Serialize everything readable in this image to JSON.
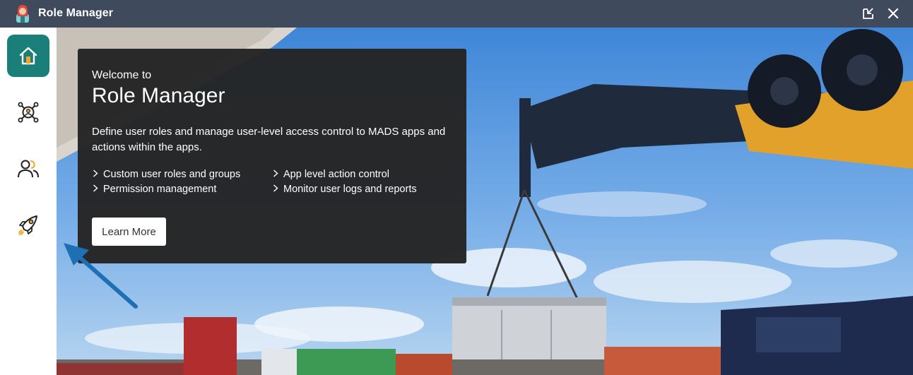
{
  "window": {
    "title": "Role Manager",
    "logo_icon": "user-avatar-icon",
    "popout_icon": "popout-icon",
    "close_icon": "close-icon"
  },
  "sidebar": {
    "items": [
      {
        "name": "home",
        "icon": "home-icon",
        "active": true
      },
      {
        "name": "network",
        "icon": "network-hub-icon",
        "active": false
      },
      {
        "name": "users",
        "icon": "users-icon",
        "active": false
      },
      {
        "name": "launch",
        "icon": "rocket-icon",
        "active": false
      }
    ]
  },
  "welcome": {
    "small": "Welcome to",
    "title": "Role Manager",
    "description": "Define user roles and manage user-level access control to MADS apps and actions within the apps.",
    "features": [
      "Custom user roles and groups",
      "Permission management",
      "App level action control",
      "Monitor user logs and reports"
    ],
    "learn_more": "Learn More"
  },
  "colors": {
    "titlebar": "#3f4b5c",
    "active_nav": "#1a7f78",
    "panel": "#242424",
    "annotation_arrow": "#1f6fb5"
  }
}
